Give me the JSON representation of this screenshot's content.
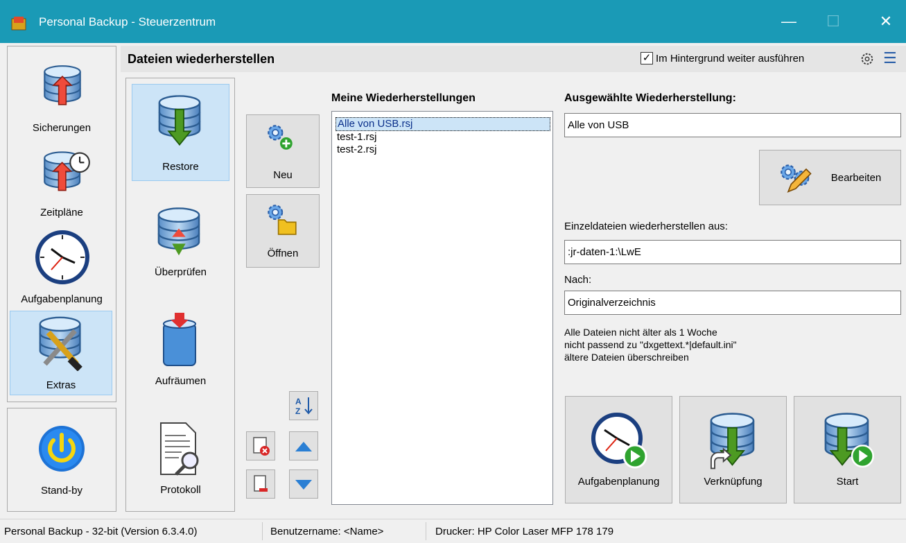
{
  "window": {
    "title": "Personal Backup - Steuerzentrum"
  },
  "sidebar": {
    "items": [
      {
        "label": "Sicherungen",
        "icon": "backup-icon"
      },
      {
        "label": "Zeitpläne",
        "icon": "schedule-icon"
      },
      {
        "label": "Aufgabenplanung",
        "icon": "clock-icon"
      },
      {
        "label": "Extras",
        "icon": "tools-icon"
      }
    ],
    "standby_label": "Stand-by"
  },
  "header": {
    "title": "Dateien wiederherstellen",
    "background_checkbox": {
      "label": "Im Hintergrund weiter ausführen",
      "checked": true
    }
  },
  "subnav": {
    "items": [
      {
        "label": "Restore"
      },
      {
        "label": "Überprüfen"
      },
      {
        "label": "Aufräumen"
      },
      {
        "label": "Protokoll"
      }
    ]
  },
  "actions": {
    "new_label": "Neu",
    "open_label": "Öffnen"
  },
  "restores": {
    "title": "Meine Wiederherstellungen",
    "items": [
      "Alle von USB.rsj",
      "test-1.rsj",
      "test-2.rsj"
    ],
    "selected_index": 0
  },
  "selected": {
    "title": "Ausgewählte Wiederherstellung:",
    "name": "Alle von USB",
    "edit_label": "Bearbeiten",
    "from_label": "Einzeldateien wiederherstellen aus:",
    "from_value": ":jr-daten-1:\\LwE",
    "to_label": "Nach:",
    "to_value": "Originalverzeichnis",
    "info_lines": [
      "Alle Dateien nicht älter als 1 Woche",
      "nicht passend zu \"dxgettext.*|default.ini\"",
      "ältere Dateien überschreiben"
    ]
  },
  "bottom_buttons": {
    "schedule_label": "Aufgabenplanung",
    "shortcut_label": "Verknüpfung",
    "start_label": "Start"
  },
  "statusbar": {
    "version": "Personal Backup - 32-bit (Version 6.3.4.0)",
    "user": "Benutzername: <Name>",
    "printer": "Drucker: HP Color Laser MFP 178 179"
  },
  "colors": {
    "titlebar": "#1a9ab6",
    "selected_bg": "#cce4f7",
    "accent_blue": "#2a7fd4",
    "arrow_red": "#e03030",
    "arrow_green": "#3a8a1a"
  }
}
